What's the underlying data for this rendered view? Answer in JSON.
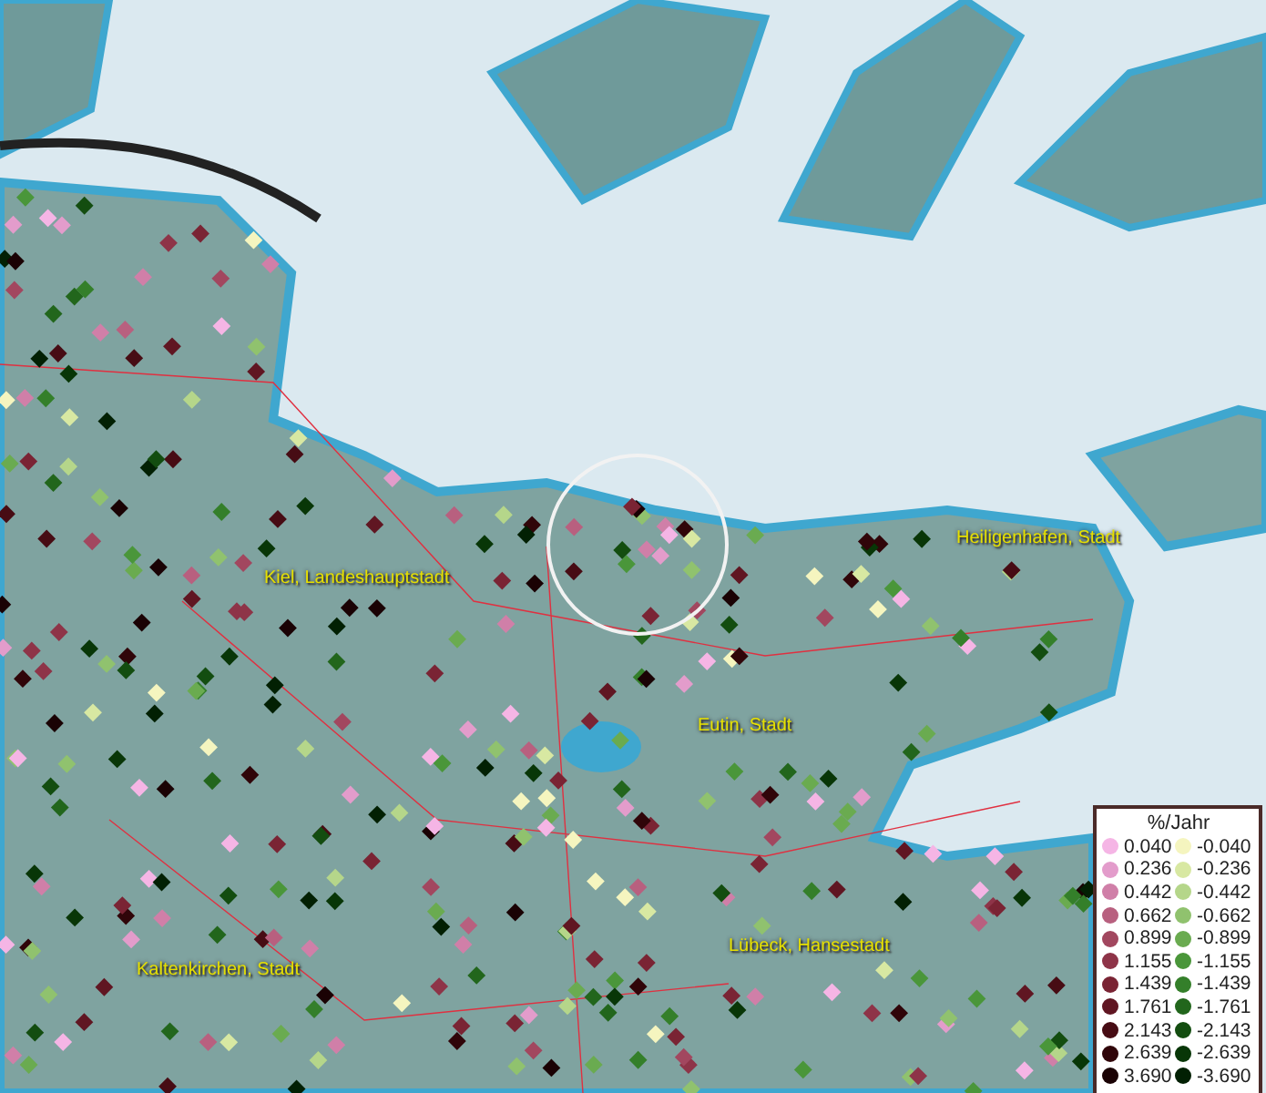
{
  "map": {
    "places": [
      {
        "name": "Kiel, Landeshauptstadt"
      },
      {
        "name": "Heiligenhafen, Stadt"
      },
      {
        "name": "Eutin, Stadt"
      },
      {
        "name": "Kaltenkirchen, Stadt"
      },
      {
        "name": "Lübeck, Hansestadt"
      }
    ]
  },
  "legend": {
    "title": "%/Jahr",
    "positive": [
      {
        "value": "0.040",
        "color": "#f5b5e5"
      },
      {
        "value": "0.236",
        "color": "#e39ccb"
      },
      {
        "value": "0.442",
        "color": "#d07fa8"
      },
      {
        "value": "0.662",
        "color": "#b8607f"
      },
      {
        "value": "0.899",
        "color": "#a2475f"
      },
      {
        "value": "1.155",
        "color": "#8e3448"
      },
      {
        "value": "1.439",
        "color": "#7a2434"
      },
      {
        "value": "1.761",
        "color": "#601622"
      },
      {
        "value": "2.143",
        "color": "#470c14"
      },
      {
        "value": "2.639",
        "color": "#300509"
      },
      {
        "value": "3.690",
        "color": "#1a0204"
      }
    ],
    "negative": [
      {
        "value": "-0.040",
        "color": "#f5f5bf"
      },
      {
        "value": "-0.236",
        "color": "#d8e8a2"
      },
      {
        "value": "-0.442",
        "color": "#b5d68a"
      },
      {
        "value": "-0.662",
        "color": "#90c26e"
      },
      {
        "value": "-0.899",
        "color": "#6aab50"
      },
      {
        "value": "-1.155",
        "color": "#4a963a"
      },
      {
        "value": "-1.439",
        "color": "#347f2a"
      },
      {
        "value": "-1.761",
        "color": "#22661c"
      },
      {
        "value": "-2.143",
        "color": "#134d10"
      },
      {
        "value": "-2.639",
        "color": "#083607"
      },
      {
        "value": "-3.690",
        "color": "#022003"
      }
    ]
  }
}
